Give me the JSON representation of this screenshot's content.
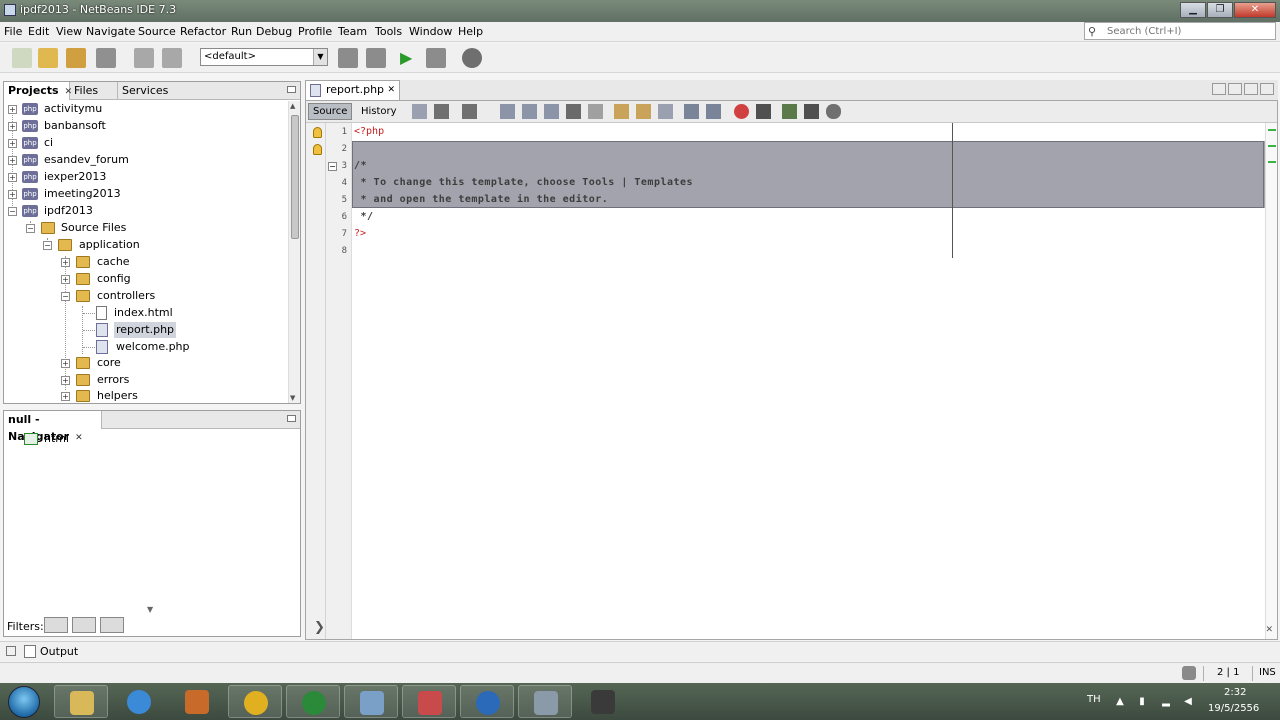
{
  "window": {
    "title": "ipdf2013 - NetBeans IDE 7.3"
  },
  "menu": [
    "File",
    "Edit",
    "View",
    "Navigate",
    "Source",
    "Refactor",
    "Run",
    "Debug",
    "Profile",
    "Team",
    "Tools",
    "Window",
    "Help"
  ],
  "search": {
    "placeholder": "Search (Ctrl+I)"
  },
  "toolbar": {
    "config_value": "<default>"
  },
  "projects_panel": {
    "tabs": [
      "Projects",
      "Files",
      "Services"
    ],
    "tree": [
      {
        "label": "activitymu"
      },
      {
        "label": "banbansoft"
      },
      {
        "label": "ci"
      },
      {
        "label": "esandev_forum"
      },
      {
        "label": "iexper2013"
      },
      {
        "label": "imeeting2013"
      },
      {
        "label": "ipdf2013"
      },
      {
        "label": "Source Files"
      },
      {
        "label": "application"
      },
      {
        "label": "cache"
      },
      {
        "label": "config"
      },
      {
        "label": "controllers"
      },
      {
        "label": "index.html"
      },
      {
        "label": "report.php"
      },
      {
        "label": "welcome.php"
      },
      {
        "label": "core"
      },
      {
        "label": "errors"
      },
      {
        "label": "helpers"
      }
    ]
  },
  "navigator_panel": {
    "title": "null - Navigator",
    "items": [
      {
        "label": "html"
      }
    ],
    "filters_label": "Filters:"
  },
  "editor": {
    "tab_label": "report.php",
    "view_tabs": [
      "Source",
      "History"
    ],
    "line_numbers": [
      "1",
      "2",
      "3",
      "4",
      "5",
      "6",
      "7",
      "8"
    ],
    "lines": [
      "<?php",
      "",
      "/*",
      " * To change this template, choose Tools | Templates",
      " * and open the template in the editor.",
      " */",
      "?>",
      ""
    ]
  },
  "output": {
    "label": "Output"
  },
  "status": {
    "position": "2 | 1",
    "mode": "INS"
  },
  "taskbar": {
    "lang": "TH",
    "time": "2:32",
    "date": "19/5/2556"
  }
}
